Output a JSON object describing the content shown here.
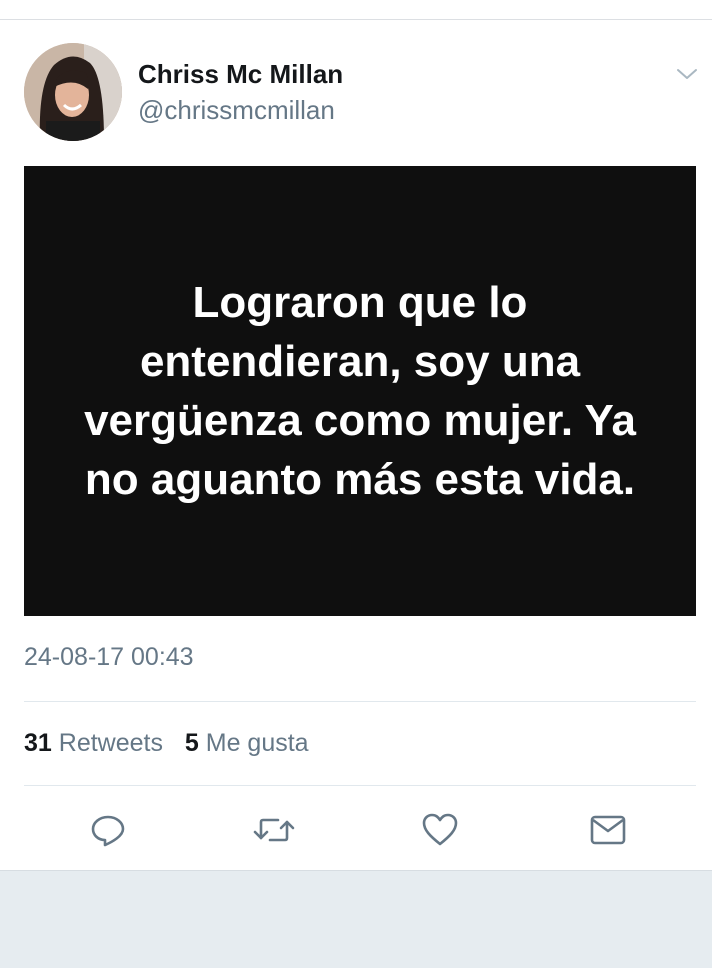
{
  "tweet": {
    "author": {
      "display_name": "Chriss Mc Millan",
      "handle": "@chrissmcmillan"
    },
    "media_text": "Lograron que lo entendieran, soy una vergüenza como mujer. Ya no aguanto más esta vida.",
    "timestamp": "24-08-17 00:43",
    "stats": {
      "retweets_count": "31",
      "retweets_label": "Retweets",
      "likes_count": "5",
      "likes_label": "Me gusta"
    },
    "actions": [
      {
        "icon": "reply-icon"
      },
      {
        "icon": "retweet-icon"
      },
      {
        "icon": "heart-icon"
      },
      {
        "icon": "message-icon"
      }
    ]
  },
  "colors": {
    "primary_text": "#14171a",
    "secondary_text": "#657786",
    "media_background": "#0f0f0f",
    "footer_background": "#e6ecf0"
  }
}
